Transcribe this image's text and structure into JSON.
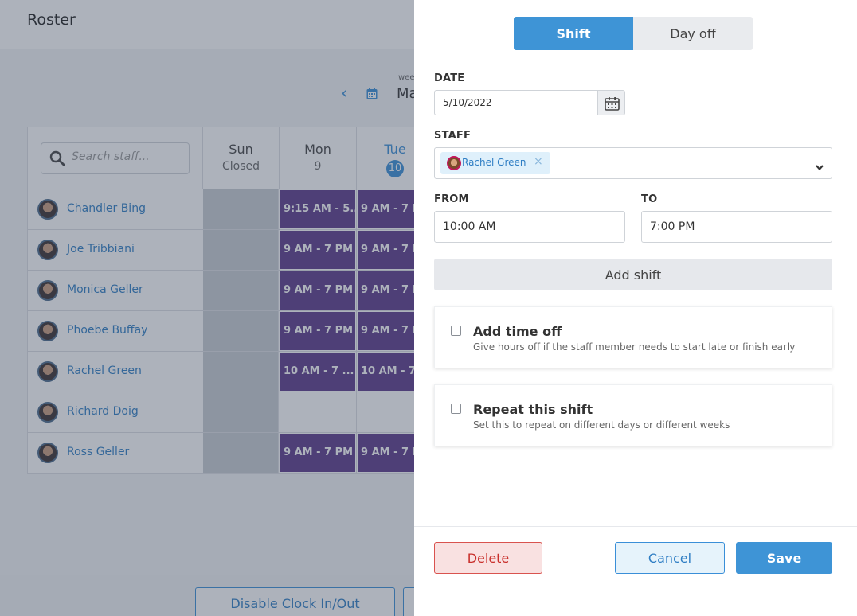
{
  "page": {
    "title": "Roster"
  },
  "week_nav": {
    "label": "wee",
    "month": "Ma"
  },
  "roster": {
    "search_placeholder": "Search staff...",
    "days": [
      {
        "name": "Sun",
        "sub": "Closed"
      },
      {
        "name": "Mon",
        "sub": "9"
      },
      {
        "name": "Tue",
        "sub": "10"
      }
    ],
    "rows": [
      {
        "name": "Chandler Bing",
        "mon": "9:15 AM - 5...",
        "tue": "9 AM - 7 P"
      },
      {
        "name": "Joe Tribbiani",
        "mon": "9 AM - 7 PM",
        "tue": "9 AM - 7 P"
      },
      {
        "name": "Monica Geller",
        "mon": "9 AM - 7 PM",
        "tue": "9 AM - 7 P"
      },
      {
        "name": "Phoebe Buffay",
        "mon": "9 AM - 7 PM",
        "tue": "9 AM - 7 P"
      },
      {
        "name": "Rachel Green",
        "mon": "10 AM - 7 ...",
        "tue": "10 AM - 7"
      },
      {
        "name": "Richard Doig",
        "mon": "",
        "tue": ""
      },
      {
        "name": "Ross Geller",
        "mon": "9 AM - 7 PM",
        "tue": "9 AM - 7 P"
      }
    ]
  },
  "bottom": {
    "clock_button": "Disable Clock In/Out"
  },
  "panel": {
    "tabs": {
      "shift": "Shift",
      "day_off": "Day off"
    },
    "date": {
      "label": "DATE",
      "value": "5/10/2022"
    },
    "staff": {
      "label": "STAFF",
      "selected": "Rachel Green",
      "remove": "×"
    },
    "from": {
      "label": "FROM",
      "value": "10:00 AM"
    },
    "to": {
      "label": "TO",
      "value": "7:00 PM"
    },
    "add_shift": "Add shift",
    "time_off": {
      "title": "Add time off",
      "desc": "Give hours off if the staff member needs to start late or finish early"
    },
    "repeat": {
      "title": "Repeat this shift",
      "desc": "Set this to repeat on different days or different weeks"
    },
    "actions": {
      "delete": "Delete",
      "cancel": "Cancel",
      "save": "Save"
    }
  },
  "colors": {
    "accent": "#3e94d6",
    "shift_block": "#5c3a8a",
    "delete": "#d9534f"
  }
}
